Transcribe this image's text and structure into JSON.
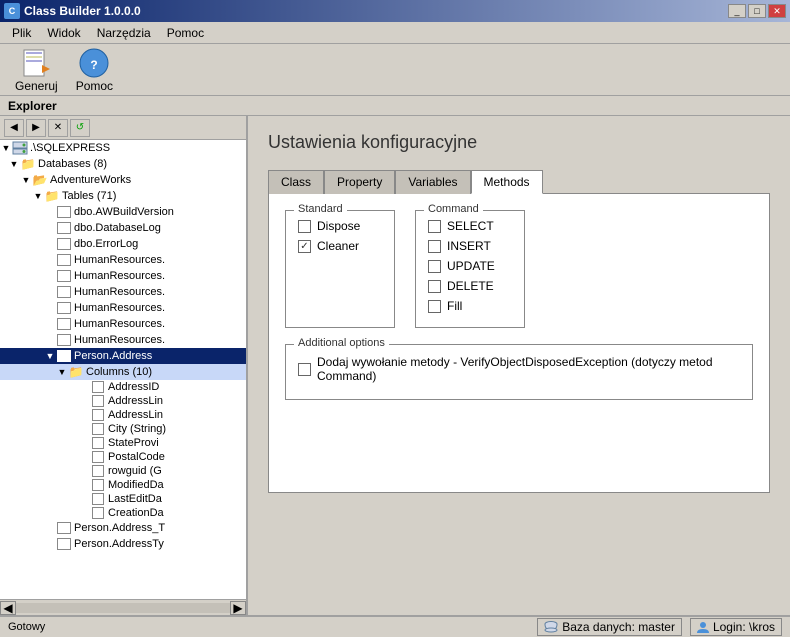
{
  "titleBar": {
    "title": "Class Builder 1.0.0.0",
    "icon": "CB",
    "buttons": [
      "_",
      "□",
      "✕"
    ]
  },
  "menuBar": {
    "items": [
      "Plik",
      "Widok",
      "Narzędzia",
      "Pomoc"
    ]
  },
  "toolbar": {
    "buttons": [
      {
        "name": "generuj-button",
        "label": "Generuj",
        "icon": "📄"
      },
      {
        "name": "pomoc-button",
        "label": "Pomoc",
        "icon": "❓"
      }
    ]
  },
  "explorer": {
    "label": "Explorer",
    "treeToolbar": [
      "◀",
      "▶",
      "✕",
      "↺"
    ],
    "tree": {
      "root": ".\\SQLEXPRESS",
      "items": [
        {
          "level": 1,
          "label": "Databases (8)",
          "expanded": true,
          "type": "folder"
        },
        {
          "level": 2,
          "label": "AdventureWorks",
          "expanded": true,
          "type": "folder"
        },
        {
          "level": 3,
          "label": "Tables (71)",
          "expanded": true,
          "type": "folder"
        },
        {
          "level": 4,
          "label": "dbo.AWBuildVersion",
          "type": "table"
        },
        {
          "level": 4,
          "label": "dbo.DatabaseLog",
          "type": "table"
        },
        {
          "level": 4,
          "label": "dbo.ErrorLog",
          "type": "table"
        },
        {
          "level": 4,
          "label": "HumanResources.",
          "type": "table"
        },
        {
          "level": 4,
          "label": "HumanResources.",
          "type": "table"
        },
        {
          "level": 4,
          "label": "HumanResources.",
          "type": "table"
        },
        {
          "level": 4,
          "label": "HumanResources.",
          "type": "table"
        },
        {
          "level": 4,
          "label": "HumanResources.",
          "type": "table"
        },
        {
          "level": 4,
          "label": "HumanResources.",
          "type": "table"
        },
        {
          "level": 4,
          "label": "Person.Address",
          "type": "table",
          "selected": true
        },
        {
          "level": 5,
          "label": "Columns (10)",
          "expanded": true,
          "type": "columns"
        },
        {
          "level": 6,
          "label": "AddressID",
          "type": "column"
        },
        {
          "level": 6,
          "label": "AddressLin",
          "type": "column"
        },
        {
          "level": 6,
          "label": "AddressLin",
          "type": "column"
        },
        {
          "level": 6,
          "label": "City (String)",
          "type": "column"
        },
        {
          "level": 6,
          "label": "StateProvi",
          "type": "column"
        },
        {
          "level": 6,
          "label": "PostalCode",
          "type": "column"
        },
        {
          "level": 6,
          "label": "rowguid (G",
          "type": "column"
        },
        {
          "level": 6,
          "label": "ModifiedDa",
          "type": "column"
        },
        {
          "level": 6,
          "label": "LastEditDa",
          "type": "column"
        },
        {
          "level": 6,
          "label": "CreationDa",
          "type": "column"
        },
        {
          "level": 4,
          "label": "Person.Address_T",
          "type": "table"
        },
        {
          "level": 4,
          "label": "Person.AddressTy",
          "type": "table"
        }
      ]
    }
  },
  "mainPanel": {
    "title": "Ustawienia konfiguracyjne",
    "tabs": [
      {
        "id": "class",
        "label": "Class"
      },
      {
        "id": "property",
        "label": "Property"
      },
      {
        "id": "variables",
        "label": "Variables"
      },
      {
        "id": "methods",
        "label": "Methods",
        "active": true
      }
    ],
    "methodsTab": {
      "standardGroup": {
        "label": "Standard",
        "items": [
          {
            "name": "Dispose",
            "checked": false
          },
          {
            "name": "Cleaner",
            "checked": true
          }
        ]
      },
      "commandGroup": {
        "label": "Command",
        "items": [
          {
            "name": "SELECT",
            "checked": false
          },
          {
            "name": "INSERT",
            "checked": false
          },
          {
            "name": "UPDATE",
            "checked": false
          },
          {
            "name": "DELETE",
            "checked": false
          },
          {
            "name": "Fill",
            "checked": false
          }
        ]
      },
      "additionalOptions": {
        "label": "Additional options",
        "items": [
          {
            "name": "verify-exception",
            "label": "Dodaj wywołanie metody - VerifyObjectDisposedException (dotyczy metod Command)",
            "checked": false
          }
        ]
      }
    }
  },
  "statusBar": {
    "left": "Gotowy",
    "right": {
      "db": "Baza danych: master",
      "login": "Login: \\kros"
    }
  }
}
